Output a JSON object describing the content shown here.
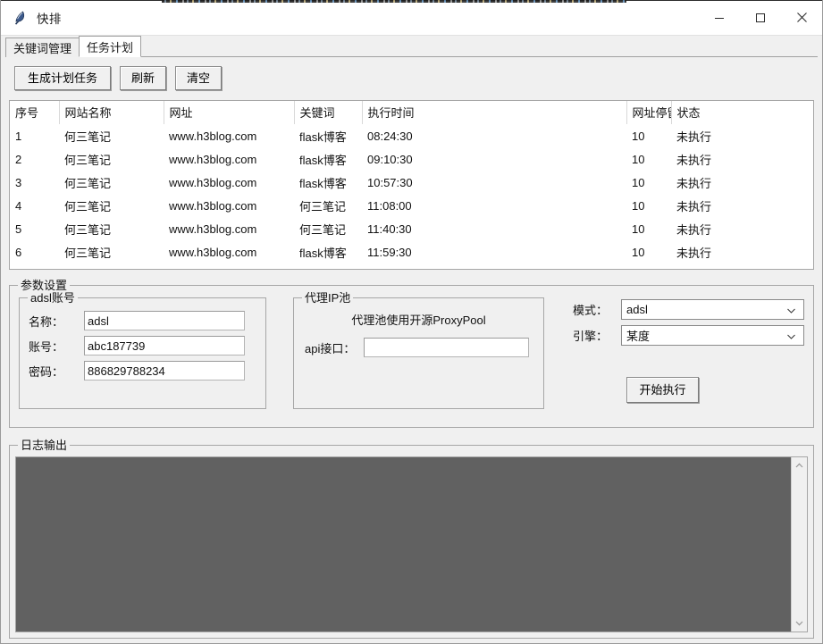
{
  "titlebar": {
    "title": "快排",
    "app_icon": "feather-icon",
    "minimize_label": "─",
    "maximize_label": "☐",
    "close_label": "✕"
  },
  "tabs": [
    {
      "label": "关键词管理",
      "active": false
    },
    {
      "label": "任务计划",
      "active": true
    }
  ],
  "toolbar": {
    "generate_label": "生成计划任务",
    "refresh_label": "刷新",
    "clear_label": "清空"
  },
  "table": {
    "columns": [
      "序号",
      "网站名称",
      "网址",
      "关键词",
      "执行时间",
      "网址停留时",
      "状态"
    ],
    "rows": [
      [
        "1",
        "何三笔记",
        "www.h3blog.com",
        "flask博客",
        "08:24:30",
        "10",
        "未执行"
      ],
      [
        "2",
        "何三笔记",
        "www.h3blog.com",
        "flask博客",
        "09:10:30",
        "10",
        "未执行"
      ],
      [
        "3",
        "何三笔记",
        "www.h3blog.com",
        "flask博客",
        "10:57:30",
        "10",
        "未执行"
      ],
      [
        "4",
        "何三笔记",
        "www.h3blog.com",
        "何三笔记",
        "11:08:00",
        "10",
        "未执行"
      ],
      [
        "5",
        "何三笔记",
        "www.h3blog.com",
        "何三笔记",
        "11:40:30",
        "10",
        "未执行"
      ],
      [
        "6",
        "何三笔记",
        "www.h3blog.com",
        "flask博客",
        "11:59:30",
        "10",
        "未执行"
      ]
    ]
  },
  "params": {
    "title": "参数设置",
    "adsl": {
      "title": "adsl账号",
      "name_label": "名称：",
      "name_value": "adsl",
      "account_label": "账号：",
      "account_value": "abc187739",
      "password_label": "密码：",
      "password_value": "886829788234"
    },
    "proxy": {
      "title": "代理IP池",
      "note": "代理池使用开源ProxyPool",
      "api_label": "api接口：",
      "api_value": "",
      "api_placeholder": ""
    },
    "mode": {
      "label": "模式：",
      "value": "adsl",
      "options": [
        "adsl"
      ]
    },
    "engine": {
      "label": "引擎：",
      "value": "某度",
      "options": [
        "某度"
      ]
    },
    "execute_label": "开始执行"
  },
  "log": {
    "title": "日志输出",
    "content": "",
    "scroll_up_icon": "chevron-up-icon",
    "scroll_down_icon": "chevron-down-icon"
  },
  "colors": {
    "window_bg": "#f0f0f0",
    "log_bg": "#616161",
    "border": "#a6a6a6",
    "text": "#111111"
  }
}
